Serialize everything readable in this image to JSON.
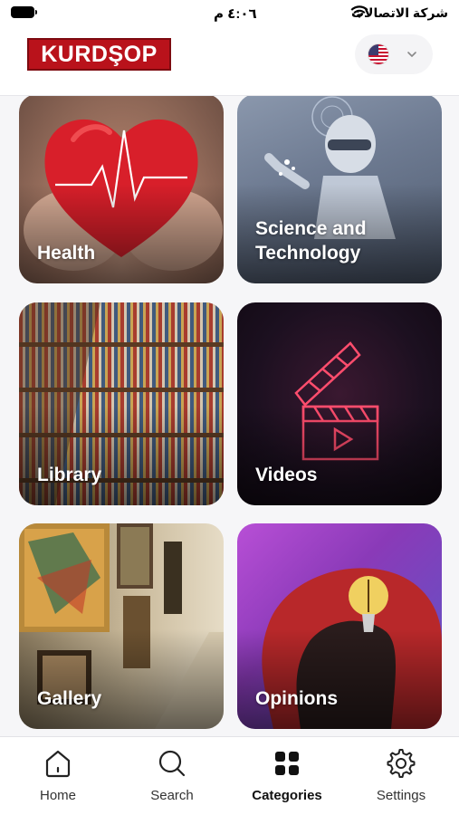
{
  "status_bar": {
    "time": "٤:٠٦ م",
    "carrier": "شركة الاتصالات"
  },
  "header": {
    "logo_text": "KURDŞOP",
    "brand_color": "#b9121b",
    "language_icon": "us-flag-icon"
  },
  "categories": [
    {
      "label": "Health"
    },
    {
      "label": "Science and Technology"
    },
    {
      "label": "Library"
    },
    {
      "label": "Videos"
    },
    {
      "label": "Gallery"
    },
    {
      "label": "Opinions"
    }
  ],
  "bottom_nav": {
    "items": [
      {
        "label": "Home",
        "icon": "home-icon"
      },
      {
        "label": "Search",
        "icon": "search-icon"
      },
      {
        "label": "Categories",
        "icon": "grid-icon",
        "active": true
      },
      {
        "label": "Settings",
        "icon": "gear-icon"
      }
    ]
  }
}
